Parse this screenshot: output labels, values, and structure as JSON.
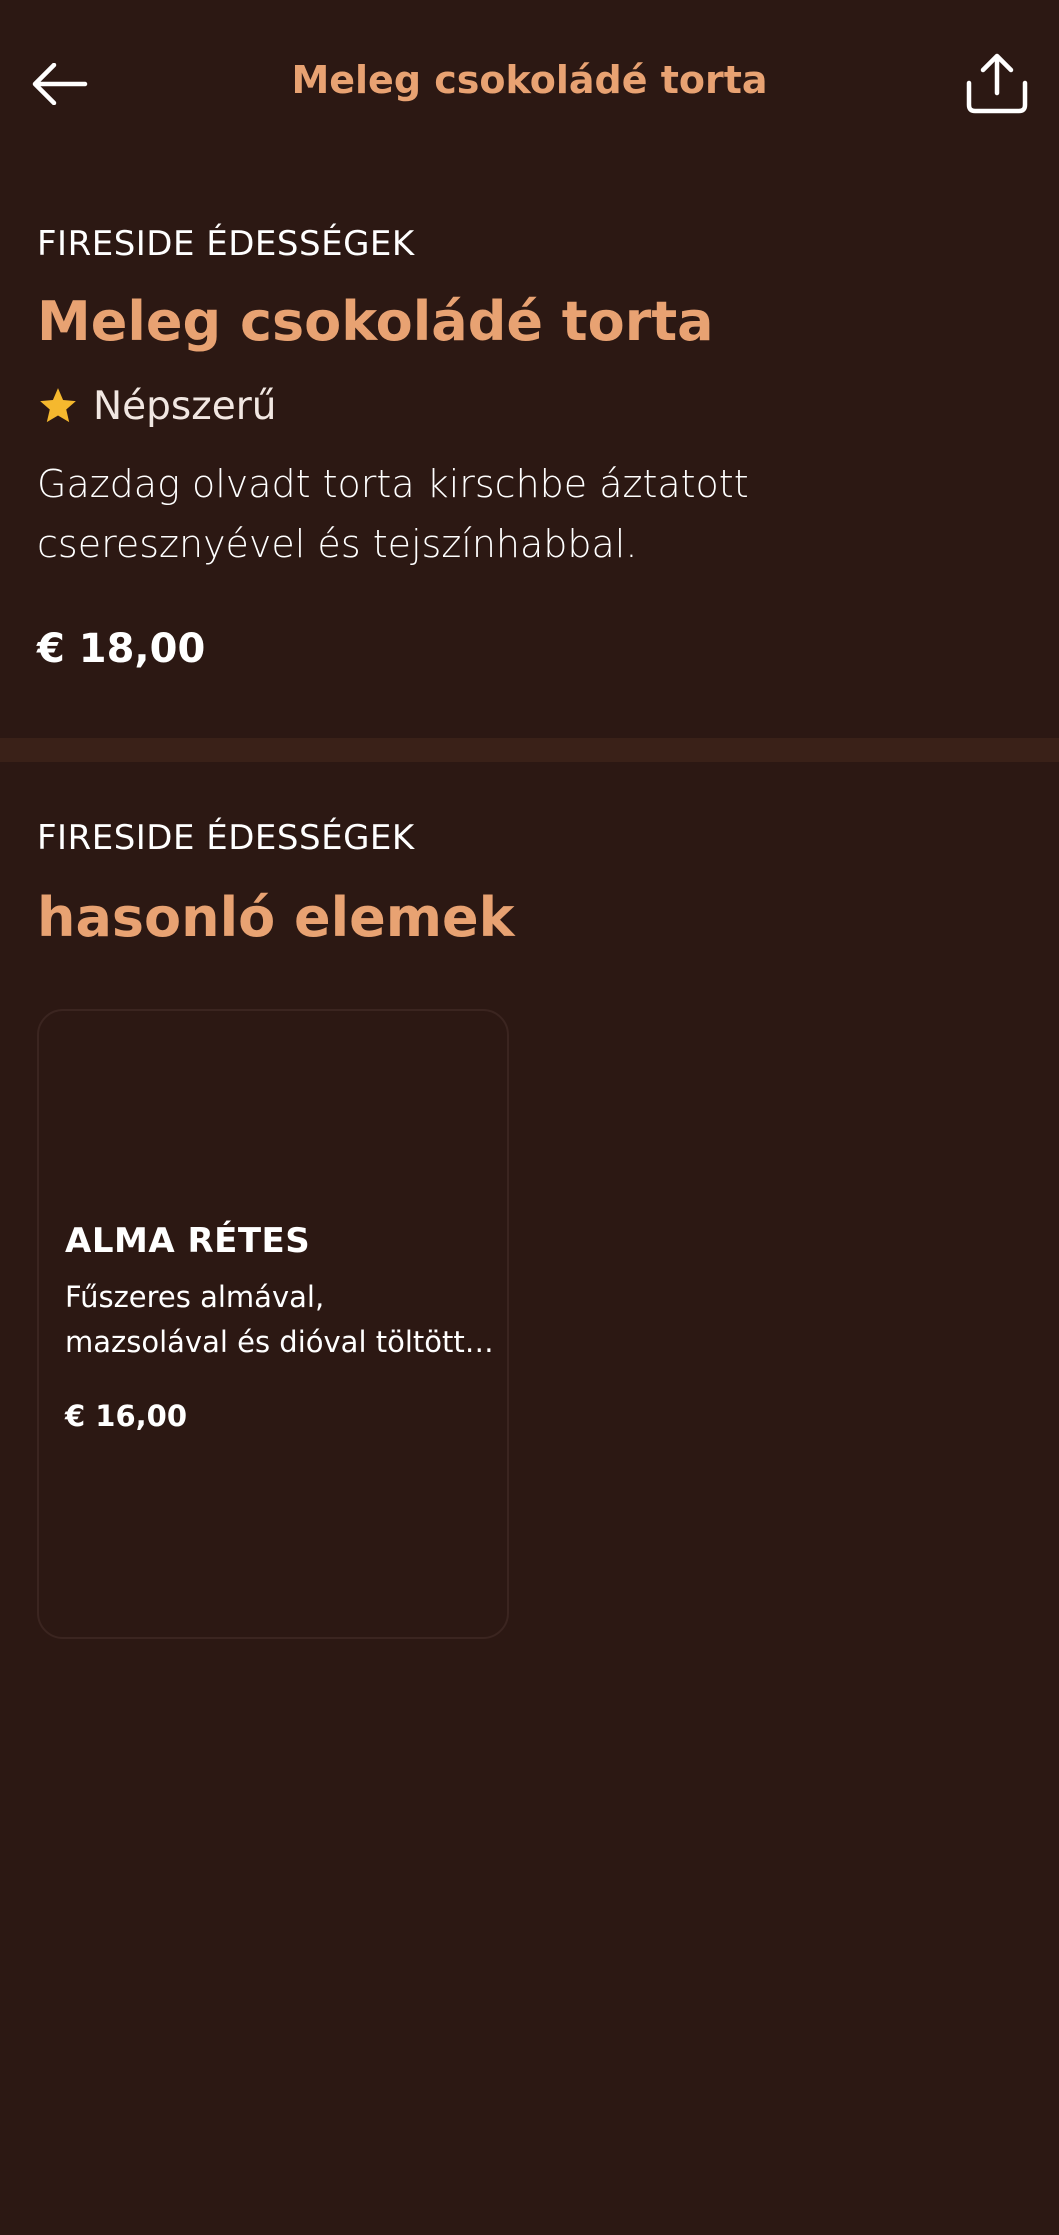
{
  "header": {
    "title": "Meleg csokoládé torta",
    "back_icon": "arrow-left-icon",
    "share_icon": "share-icon"
  },
  "item": {
    "category": "FIRESIDE ÉDESSÉGEK",
    "name": "Meleg csokoládé torta",
    "badge": "Népszerű",
    "badge_icon": "star-icon",
    "description": "Gazdag olvadt torta kirschbe áztatott cseresznyével és tejszínhabbal.",
    "price": "€ 18,00"
  },
  "similar": {
    "category": "FIRESIDE ÉDESSÉGEK",
    "heading": "hasonló elemek",
    "items": [
      {
        "name": "ALMA RÉTES",
        "description": "Fűszeres almával, mazsolával és dióval töltött pelyhes...",
        "price": "€ 16,00"
      }
    ]
  },
  "colors": {
    "background": "#2c1813",
    "accent": "#e8a272",
    "star": "#f5b82e",
    "divider": "#3a2118",
    "card_border": "#3b2520"
  }
}
